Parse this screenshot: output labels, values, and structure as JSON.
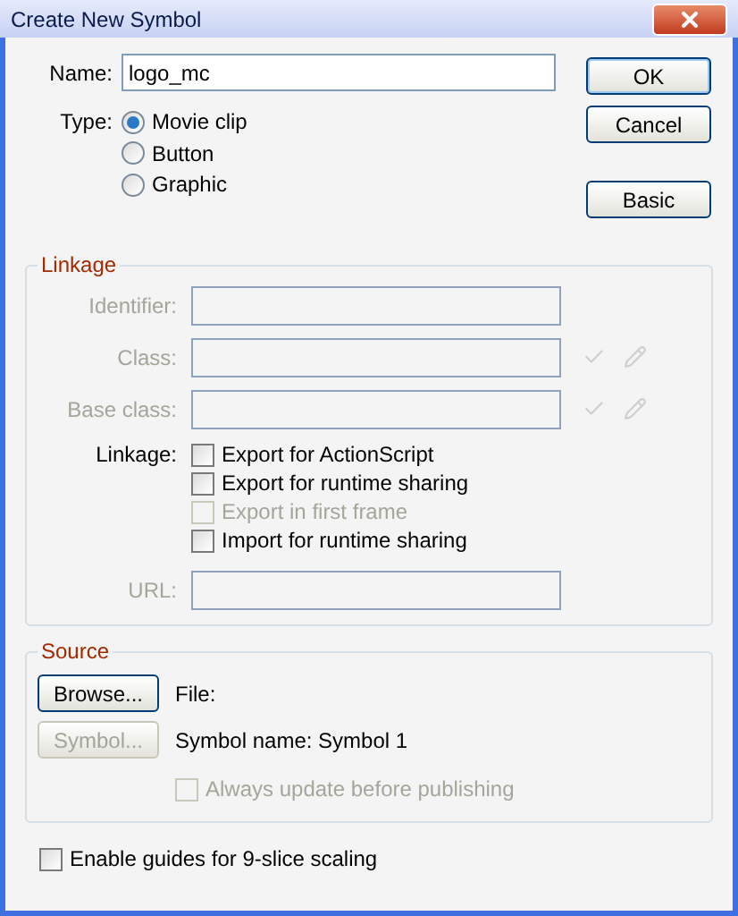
{
  "window": {
    "title": "Create New Symbol"
  },
  "name": {
    "label": "Name:",
    "value": "logo_mc"
  },
  "type": {
    "label": "Type:",
    "options": [
      {
        "label": "Movie clip",
        "selected": true
      },
      {
        "label": "Button",
        "selected": false
      },
      {
        "label": "Graphic",
        "selected": false
      }
    ]
  },
  "buttons": [
    {
      "label": "OK",
      "default": true
    },
    {
      "label": "Cancel",
      "default": false
    },
    {
      "label": "Basic",
      "default": false
    }
  ],
  "linkage": {
    "title": "Linkage",
    "fields": [
      {
        "label": "Identifier:",
        "disabled": true,
        "tools": false
      },
      {
        "label": "Class:",
        "disabled": true,
        "tools": true
      },
      {
        "label": "Base class:",
        "disabled": true,
        "tools": true
      }
    ],
    "options_label": "Linkage:",
    "options": [
      {
        "label": "Export for ActionScript",
        "checked": false,
        "disabled": false
      },
      {
        "label": "Export for runtime sharing",
        "checked": false,
        "disabled": false
      },
      {
        "label": "Export in first frame",
        "checked": false,
        "disabled": true
      },
      {
        "label": "Import for runtime sharing",
        "checked": false,
        "disabled": false
      }
    ],
    "url": {
      "label": "URL:",
      "disabled": true
    }
  },
  "source": {
    "title": "Source",
    "browse": {
      "label": "Browse...",
      "disabled": false
    },
    "file_label": "File:",
    "symbol": {
      "label": "Symbol...",
      "disabled": true
    },
    "symbol_name": "Symbol name: Symbol 1",
    "always_update": {
      "label": "Always update before publishing",
      "checked": false,
      "disabled": true
    }
  },
  "nine_slice": {
    "label": "Enable guides for 9-slice scaling",
    "checked": false,
    "disabled": false
  }
}
